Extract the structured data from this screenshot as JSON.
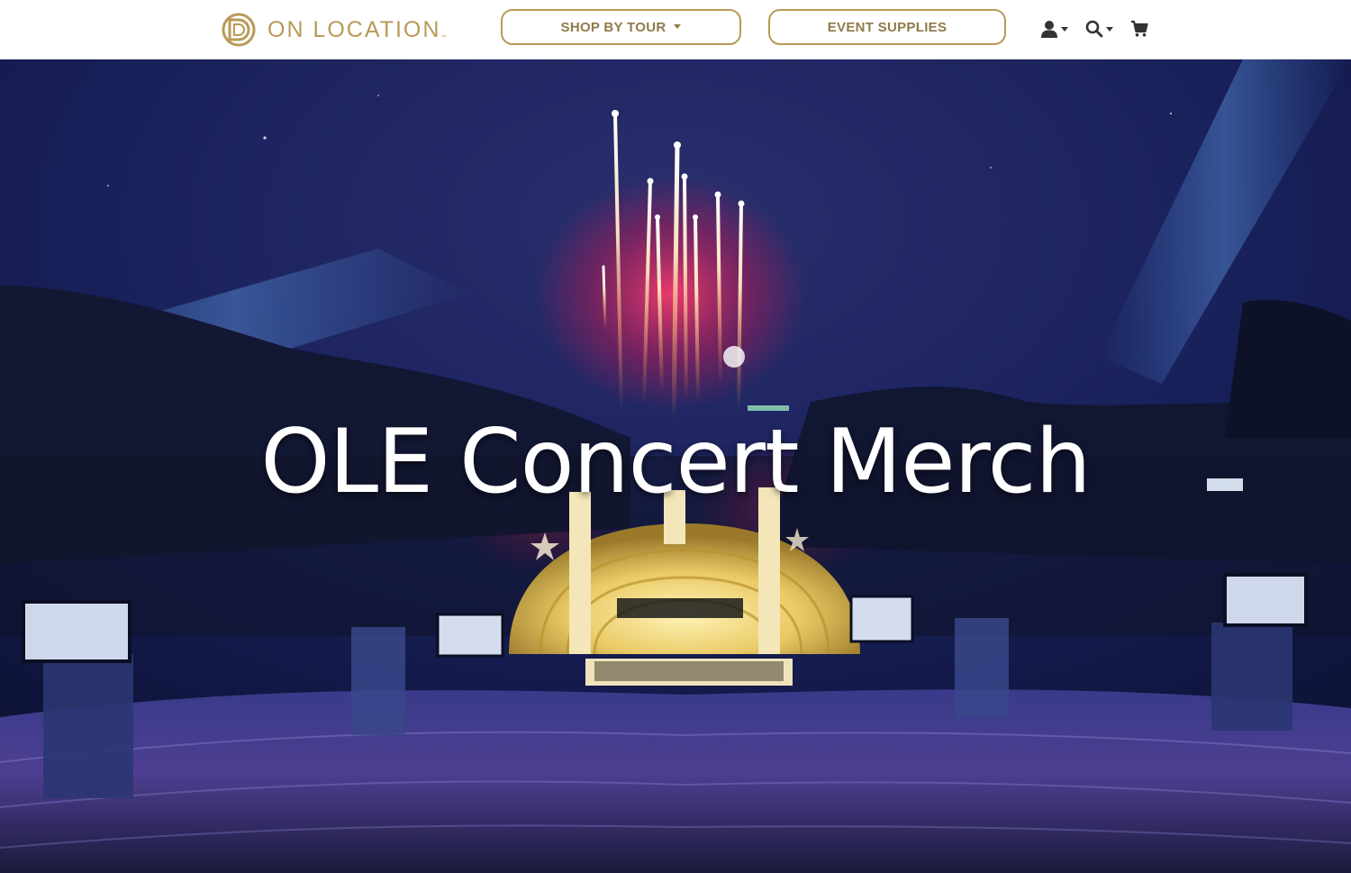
{
  "header": {
    "logo_text": "ON LOCATION",
    "logo_tm": "™",
    "nav": {
      "shop_by_tour_label": "SHOP BY TOUR",
      "event_supplies_label": "EVENT SUPPLIES"
    },
    "icons": [
      "user-icon",
      "search-icon",
      "cart-icon"
    ]
  },
  "hero": {
    "title": "OLE Concert Merch"
  },
  "colors": {
    "brand_gold": "#b99a56",
    "brand_gold_text": "#8f7a48",
    "night_sky": "#141c48",
    "hero_title": "#ffffff"
  }
}
